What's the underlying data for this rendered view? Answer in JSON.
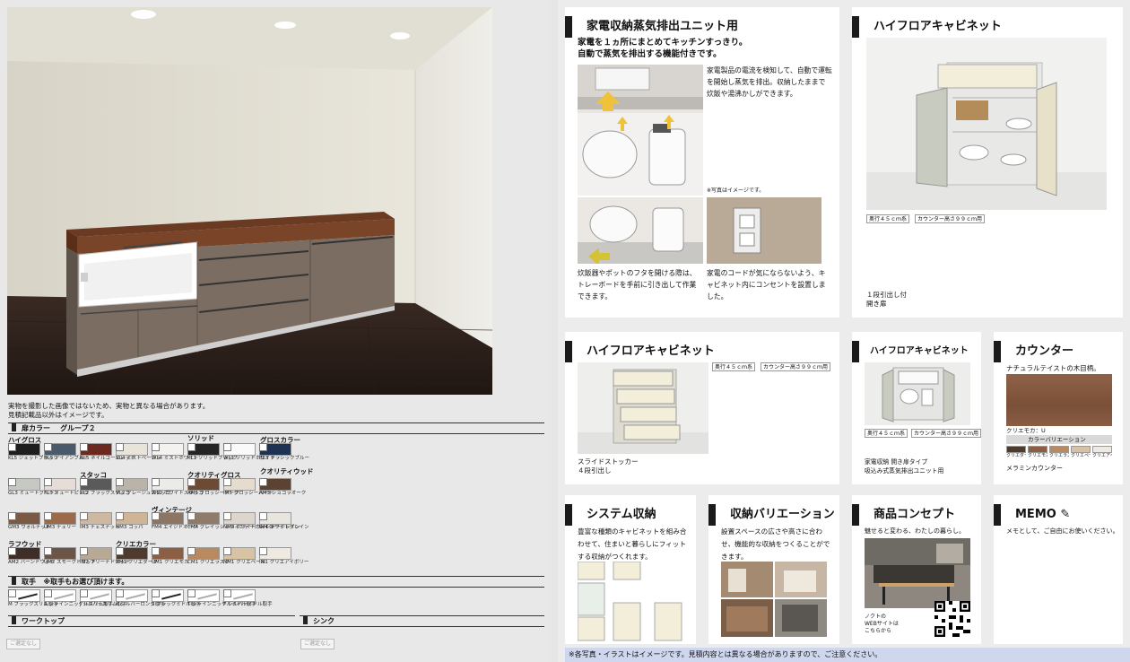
{
  "disclaimer": {
    "line1": "実物を撮影した画像ではないため、実物と異なる場合があります。",
    "line2": "見積記載品以外はイメージです。"
  },
  "door_color": {
    "heading": "扉カラー",
    "group": "グループ２",
    "groups": {
      "high_gloss": "ハイグロス",
      "solid": "ソリッド",
      "gloss_color": "グロスカラー",
      "stucco": "スタッコ",
      "quality_gloss": "クオリティグロス",
      "quality_wood": "クオリティウッド",
      "vintage": "ヴィンテージ",
      "rough_wood": "ラフウッド",
      "clearia_color": "クリエカラー"
    },
    "row1": [
      {
        "code": "KL5",
        "name": "ジェットブラック",
        "color": "#1e1e1e"
      },
      {
        "code": "BL5",
        "name": "アイアンブルー",
        "color": "#4a5a6a"
      },
      {
        "code": "RL5",
        "name": "ネイルゴールレット",
        "color": "#6b2a20"
      },
      {
        "code": "VL4",
        "name": "ミストベージュ",
        "color": "#e9e4da"
      },
      {
        "code": "WL4",
        "name": "ミストホワイト",
        "color": "#f4f2ee"
      },
      {
        "code": "KL1",
        "name": "ソリッドブラック",
        "color": "#242424"
      },
      {
        "code": "WL1",
        "name": "ソリッドホワイト",
        "color": "#fafafa"
      },
      {
        "code": "BL3",
        "name": "クラシックブルー",
        "color": "#1e3254"
      }
    ],
    "row2": [
      {
        "code": "GL3",
        "name": "ミュートグリーン",
        "color": "#c6c9c1"
      },
      {
        "code": "PL3",
        "name": "ミュートピンク",
        "color": "#e6ddd8"
      },
      {
        "code": "KL2",
        "name": "ブラックスタッコ",
        "color": "#5a5a5a"
      },
      {
        "code": "VL2",
        "name": "グレージュスタッコ",
        "color": "#b9b3aa"
      },
      {
        "code": "WL2",
        "name": "ホワイトスタッコ",
        "color": "#ebebe8"
      },
      {
        "code": "AM5",
        "name": "グロッシーチーク",
        "color": "#6d4a33"
      },
      {
        "code": "IM5",
        "name": "グロッシーバーチ",
        "color": "#e6dccd"
      },
      {
        "code": "AM3",
        "name": "ショコラオーク",
        "color": "#5b4231"
      }
    ],
    "row3": [
      {
        "code": "GM3",
        "name": "ウォルナット",
        "color": "#7a5a44"
      },
      {
        "code": "UM3",
        "name": "チェリー",
        "color": "#9b6a4a"
      },
      {
        "code": "IM3",
        "name": "チェスナット",
        "color": "#cdb9a2"
      },
      {
        "code": "NM3",
        "name": "コッパ",
        "color": "#cfb596"
      },
      {
        "code": "FM4",
        "name": "エイジドオーク",
        "color": "#8c7663"
      },
      {
        "code": "CM4",
        "name": "グレイッシュヴィンテージレイン",
        "color": "#8f7b6a"
      },
      {
        "code": "NM4",
        "name": "ホワイトヴィンテージレイン",
        "color": "#ddd6cc"
      },
      {
        "code": "IM4",
        "name": "ホワイトグレイン",
        "color": "#e8e4de"
      }
    ],
    "row4": [
      {
        "code": "AM2",
        "name": "バーンドウッド",
        "color": "#3d2e27"
      },
      {
        "code": "UM2",
        "name": "スモークドウッド",
        "color": "#6a5546"
      },
      {
        "code": "IM2",
        "name": "ブリーチドウッド",
        "color": "#b8a996"
      },
      {
        "code": "AM1",
        "name": "クリエダーク",
        "color": "#4e3a2e"
      },
      {
        "code": "UM1",
        "name": "クリエモカ",
        "color": "#8a5f43"
      },
      {
        "code": "CM1",
        "name": "クリエラスク",
        "color": "#b98a5f"
      },
      {
        "code": "NM1",
        "name": "クリエペール",
        "color": "#d7c2a3"
      },
      {
        "code": "IM1",
        "name": "クリエアイボリー",
        "color": "#eeeae2"
      }
    ]
  },
  "handle": {
    "heading": "取手",
    "note": "※取手もお選び頂けます。",
    "items": [
      {
        "code": "M",
        "name": "ブラックスリム取手"
      },
      {
        "code": "R",
        "name": "シャインニッケルスリム取手"
      },
      {
        "code": "J",
        "name": "シルバースリム取手"
      },
      {
        "code": "K",
        "name": "シルバーロング取手"
      },
      {
        "code": "S",
        "name": "ブラックミドル取手"
      },
      {
        "code": "T",
        "name": "シャインニッケルミドル取手"
      },
      {
        "code": "P",
        "name": "シルバーミドル取手"
      }
    ]
  },
  "worktop": {
    "heading": "ワークトップ",
    "value": "ご選定なし"
  },
  "sink": {
    "heading": "シンク",
    "value": "ご選定なし"
  },
  "cards": {
    "steam": {
      "title": "家電収納蒸気排出ユニット用",
      "lead1": "家電を１ヵ所にまとめてキッチンすっきり。",
      "lead2": "自動で蒸気を排出する機能付きです。",
      "desc": "家電製品の電流を検知して、自動で運転を開始し蒸気を排出。収納したままで炊飯や湯沸かしができます。",
      "photo_note": "※写真はイメージです。",
      "tray": "炊飯器やポットのフタを開ける際は、トレーボードを手前に引き出して作業できます。",
      "cord": "家電のコードが気にならないよう、キャビネット内にコンセントを設置しました。"
    },
    "hf1": {
      "title": "ハイフロアキャビネット",
      "tag1": "奥行４５ｃｍ系",
      "tag2": "カウンター高さ９９ｃｍ用",
      "spec1": "１段引出し付",
      "spec2": "開き扉"
    },
    "hf2": {
      "title": "ハイフロアキャビネット",
      "tag1": "奥行４５ｃｍ系",
      "tag2": "カウンター高さ９９ｃｍ用",
      "spec1": "スライドストッカー",
      "spec2": "４段引出し"
    },
    "hf3": {
      "title": "ハイフロアキャビネット",
      "tag1": "奥行４５ｃｍ系",
      "tag2": "カウンター高さ９９ｃｍ用",
      "spec1": "家電収納 開き扉タイプ",
      "spec2": "吸込み式蒸気排出ユニット用"
    },
    "counter": {
      "title": "カウンター",
      "desc": "ナチュラルテイストの木目柄。",
      "color_label": "クリエモカ：U",
      "variation": "カラーバリエーション",
      "swatches": [
        {
          "name": "クリエダーク",
          "color": "#4e3a2e"
        },
        {
          "name": "クリエモカ",
          "color": "#8a5f43"
        },
        {
          "name": "クリエラスク",
          "color": "#b98a5f"
        },
        {
          "name": "クリエペール",
          "color": "#d7c2a3"
        },
        {
          "name": "クリエアイボリー",
          "color": "#eeeae2"
        }
      ],
      "type": "メラミンカウンター"
    },
    "system": {
      "title": "システム収納",
      "desc": "豊富な種類のキャビネットを組み合わせて、住まいと暮らしにフィットする収納がつくれます。"
    },
    "variation": {
      "title": "収納バリエーション",
      "desc": "設置スペースの広さや高さに合わせ、機能的な収納をつくることができます。"
    },
    "concept": {
      "title": "商品コンセプト",
      "desc": "魅せると変わる、わたしの暮らし。",
      "web1": "ノクトの",
      "web2": "WEBサイトは",
      "web3": "こちらから"
    },
    "memo": {
      "title": "MEMO",
      "desc": "メモとして、ご自由にお使いください。"
    }
  },
  "footer": "※各写真・イラストはイメージです。見積内容とは異なる場合がありますので、ご注意ください。"
}
